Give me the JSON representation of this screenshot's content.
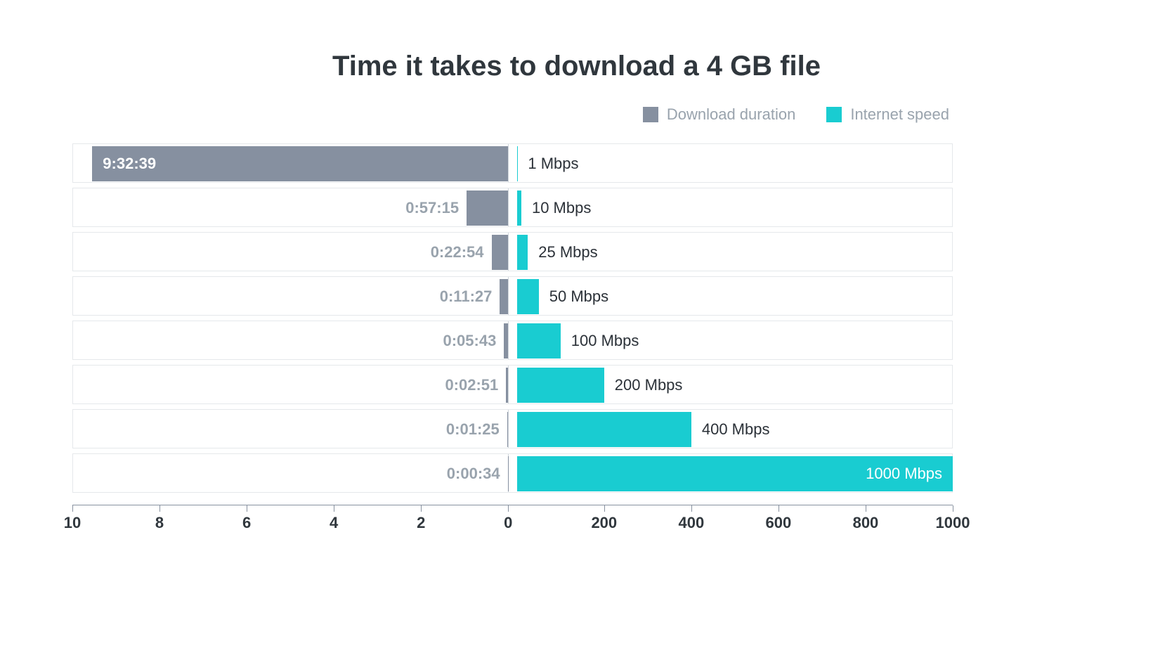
{
  "colors": {
    "duration": "#8690a0",
    "speed": "#19ccd1",
    "border": "#e5e8eb",
    "title": "#30373d",
    "muted": "#99a3ad",
    "dark": "#2b3138"
  },
  "chart_data": {
    "type": "bar",
    "title": "Time it takes to download a 4 GB file",
    "legend": {
      "duration": "Download duration",
      "speed": "Internet speed"
    },
    "left_axis": {
      "label": "",
      "unit": "hours",
      "max": 10,
      "ticks": [
        10,
        8,
        6,
        4,
        2,
        0
      ]
    },
    "right_axis": {
      "label": "",
      "unit": "Mbps",
      "max": 1000,
      "ticks": [
        0,
        200,
        400,
        600,
        800,
        1000
      ]
    },
    "rows": [
      {
        "duration_label": "9:32:39",
        "duration_hours": 9.544,
        "speed_mbps": 1,
        "speed_label": "1 Mbps"
      },
      {
        "duration_label": "0:57:15",
        "duration_hours": 0.954,
        "speed_mbps": 10,
        "speed_label": "10 Mbps"
      },
      {
        "duration_label": "0:22:54",
        "duration_hours": 0.382,
        "speed_mbps": 25,
        "speed_label": "25 Mbps"
      },
      {
        "duration_label": "0:11:27",
        "duration_hours": 0.191,
        "speed_mbps": 50,
        "speed_label": "50 Mbps"
      },
      {
        "duration_label": "0:05:43",
        "duration_hours": 0.0953,
        "speed_mbps": 100,
        "speed_label": "100 Mbps"
      },
      {
        "duration_label": "0:02:51",
        "duration_hours": 0.0475,
        "speed_mbps": 200,
        "speed_label": "200 Mbps"
      },
      {
        "duration_label": "0:01:25",
        "duration_hours": 0.0236,
        "speed_mbps": 400,
        "speed_label": "400 Mbps"
      },
      {
        "duration_label": "0:00:34",
        "duration_hours": 0.0094,
        "speed_mbps": 1000,
        "speed_label": "1000 Mbps"
      }
    ]
  }
}
